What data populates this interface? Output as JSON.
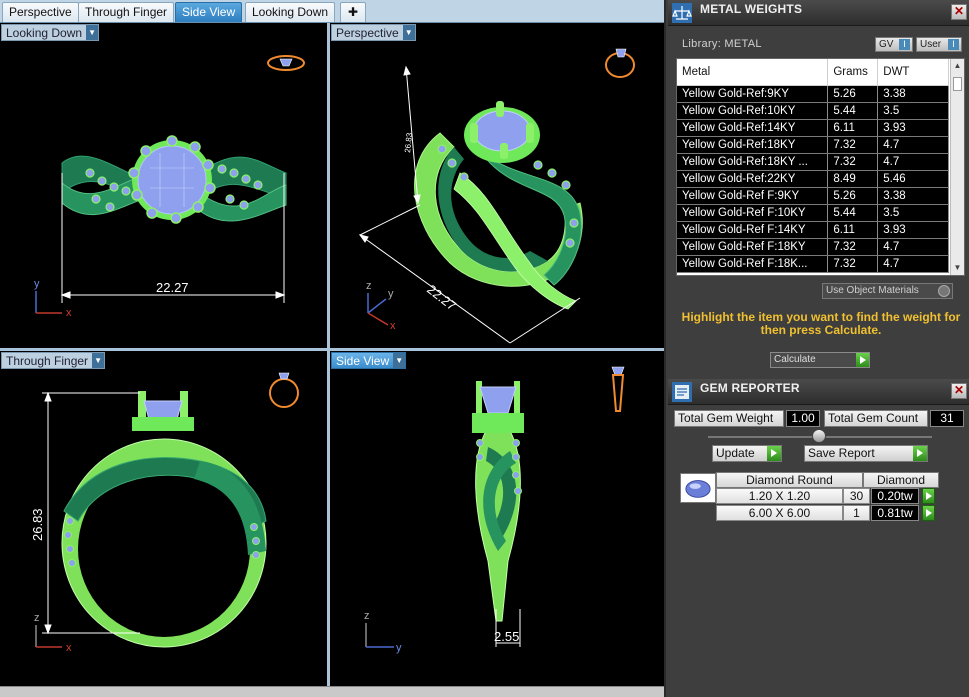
{
  "tabs": [
    {
      "label": "Perspective",
      "active": false
    },
    {
      "label": "Through Finger",
      "active": false
    },
    {
      "label": "Side View",
      "active": true
    },
    {
      "label": "Looking Down",
      "active": false
    }
  ],
  "add_tab_glyph": "✚",
  "viewports": {
    "top_left": {
      "label": "Looking Down",
      "dimension": "22.27",
      "axis_up": "y",
      "axis_right": "x"
    },
    "top_right": {
      "label": "Perspective",
      "dimension_a": "22.27",
      "dimension_b": "26.83",
      "axis_up": "z",
      "axis_right": "y",
      "axis_diag": "x"
    },
    "bottom_left": {
      "label": "Through Finger",
      "dimension": "26.83",
      "axis_up": "z",
      "axis_right": "x"
    },
    "bottom_right": {
      "label": "Side View",
      "dimension": "2.55",
      "axis_up": "z",
      "axis_right": "y"
    }
  },
  "metal_weights": {
    "title": "METAL WEIGHTS",
    "library_label": "Library: METAL",
    "gv_button": "GV",
    "user_button": "User",
    "columns": [
      "Metal",
      "Grams",
      "DWT"
    ],
    "rows": [
      [
        "Yellow Gold-Ref:9KY",
        "5.26",
        "3.38"
      ],
      [
        "Yellow Gold-Ref:10KY",
        "5.44",
        "3.5"
      ],
      [
        "Yellow Gold-Ref:14KY",
        "6.11",
        "3.93"
      ],
      [
        "Yellow Gold-Ref:18KY",
        "7.32",
        "4.7"
      ],
      [
        "Yellow Gold-Ref:18KY ...",
        "7.32",
        "4.7"
      ],
      [
        "Yellow Gold-Ref:22KY",
        "8.49",
        "5.46"
      ],
      [
        "Yellow Gold-Ref F:9KY",
        "5.26",
        "3.38"
      ],
      [
        "Yellow Gold-Ref F:10KY",
        "5.44",
        "3.5"
      ],
      [
        "Yellow Gold-Ref F:14KY",
        "6.11",
        "3.93"
      ],
      [
        "Yellow Gold-Ref F:18KY",
        "7.32",
        "4.7"
      ],
      [
        "Yellow Gold-Ref F:18K...",
        "7.32",
        "4.7"
      ]
    ],
    "use_object_materials": "Use Object Materials",
    "hint": "Highlight the item you want to find the weight for then press Calculate.",
    "calculate_label": "Calculate"
  },
  "gem_reporter": {
    "title": "GEM REPORTER",
    "total_gem_weight_label": "Total Gem Weight",
    "total_gem_weight": "1.00",
    "total_gem_count_label": "Total Gem Count",
    "total_gem_count": "31",
    "update_label": "Update",
    "save_report_label": "Save Report",
    "gem_group": {
      "shape": "Diamond Round",
      "material": "Diamond",
      "rows": [
        {
          "size": "1.20 X 1.20",
          "count": "30",
          "weight": "0.20tw"
        },
        {
          "size": "6.00 X 6.00",
          "count": "1",
          "weight": "0.81tw"
        }
      ]
    }
  },
  "colors": {
    "viewport_bg": "#000000",
    "ring_light_green": "#8cf06a",
    "ring_dark_green": "#1e7a50",
    "gem_blue": "#8fa0ee",
    "tab_active": "#3a8ccc",
    "hint_yellow": "#f0c030",
    "panel_bg": "#3e3e3e"
  }
}
